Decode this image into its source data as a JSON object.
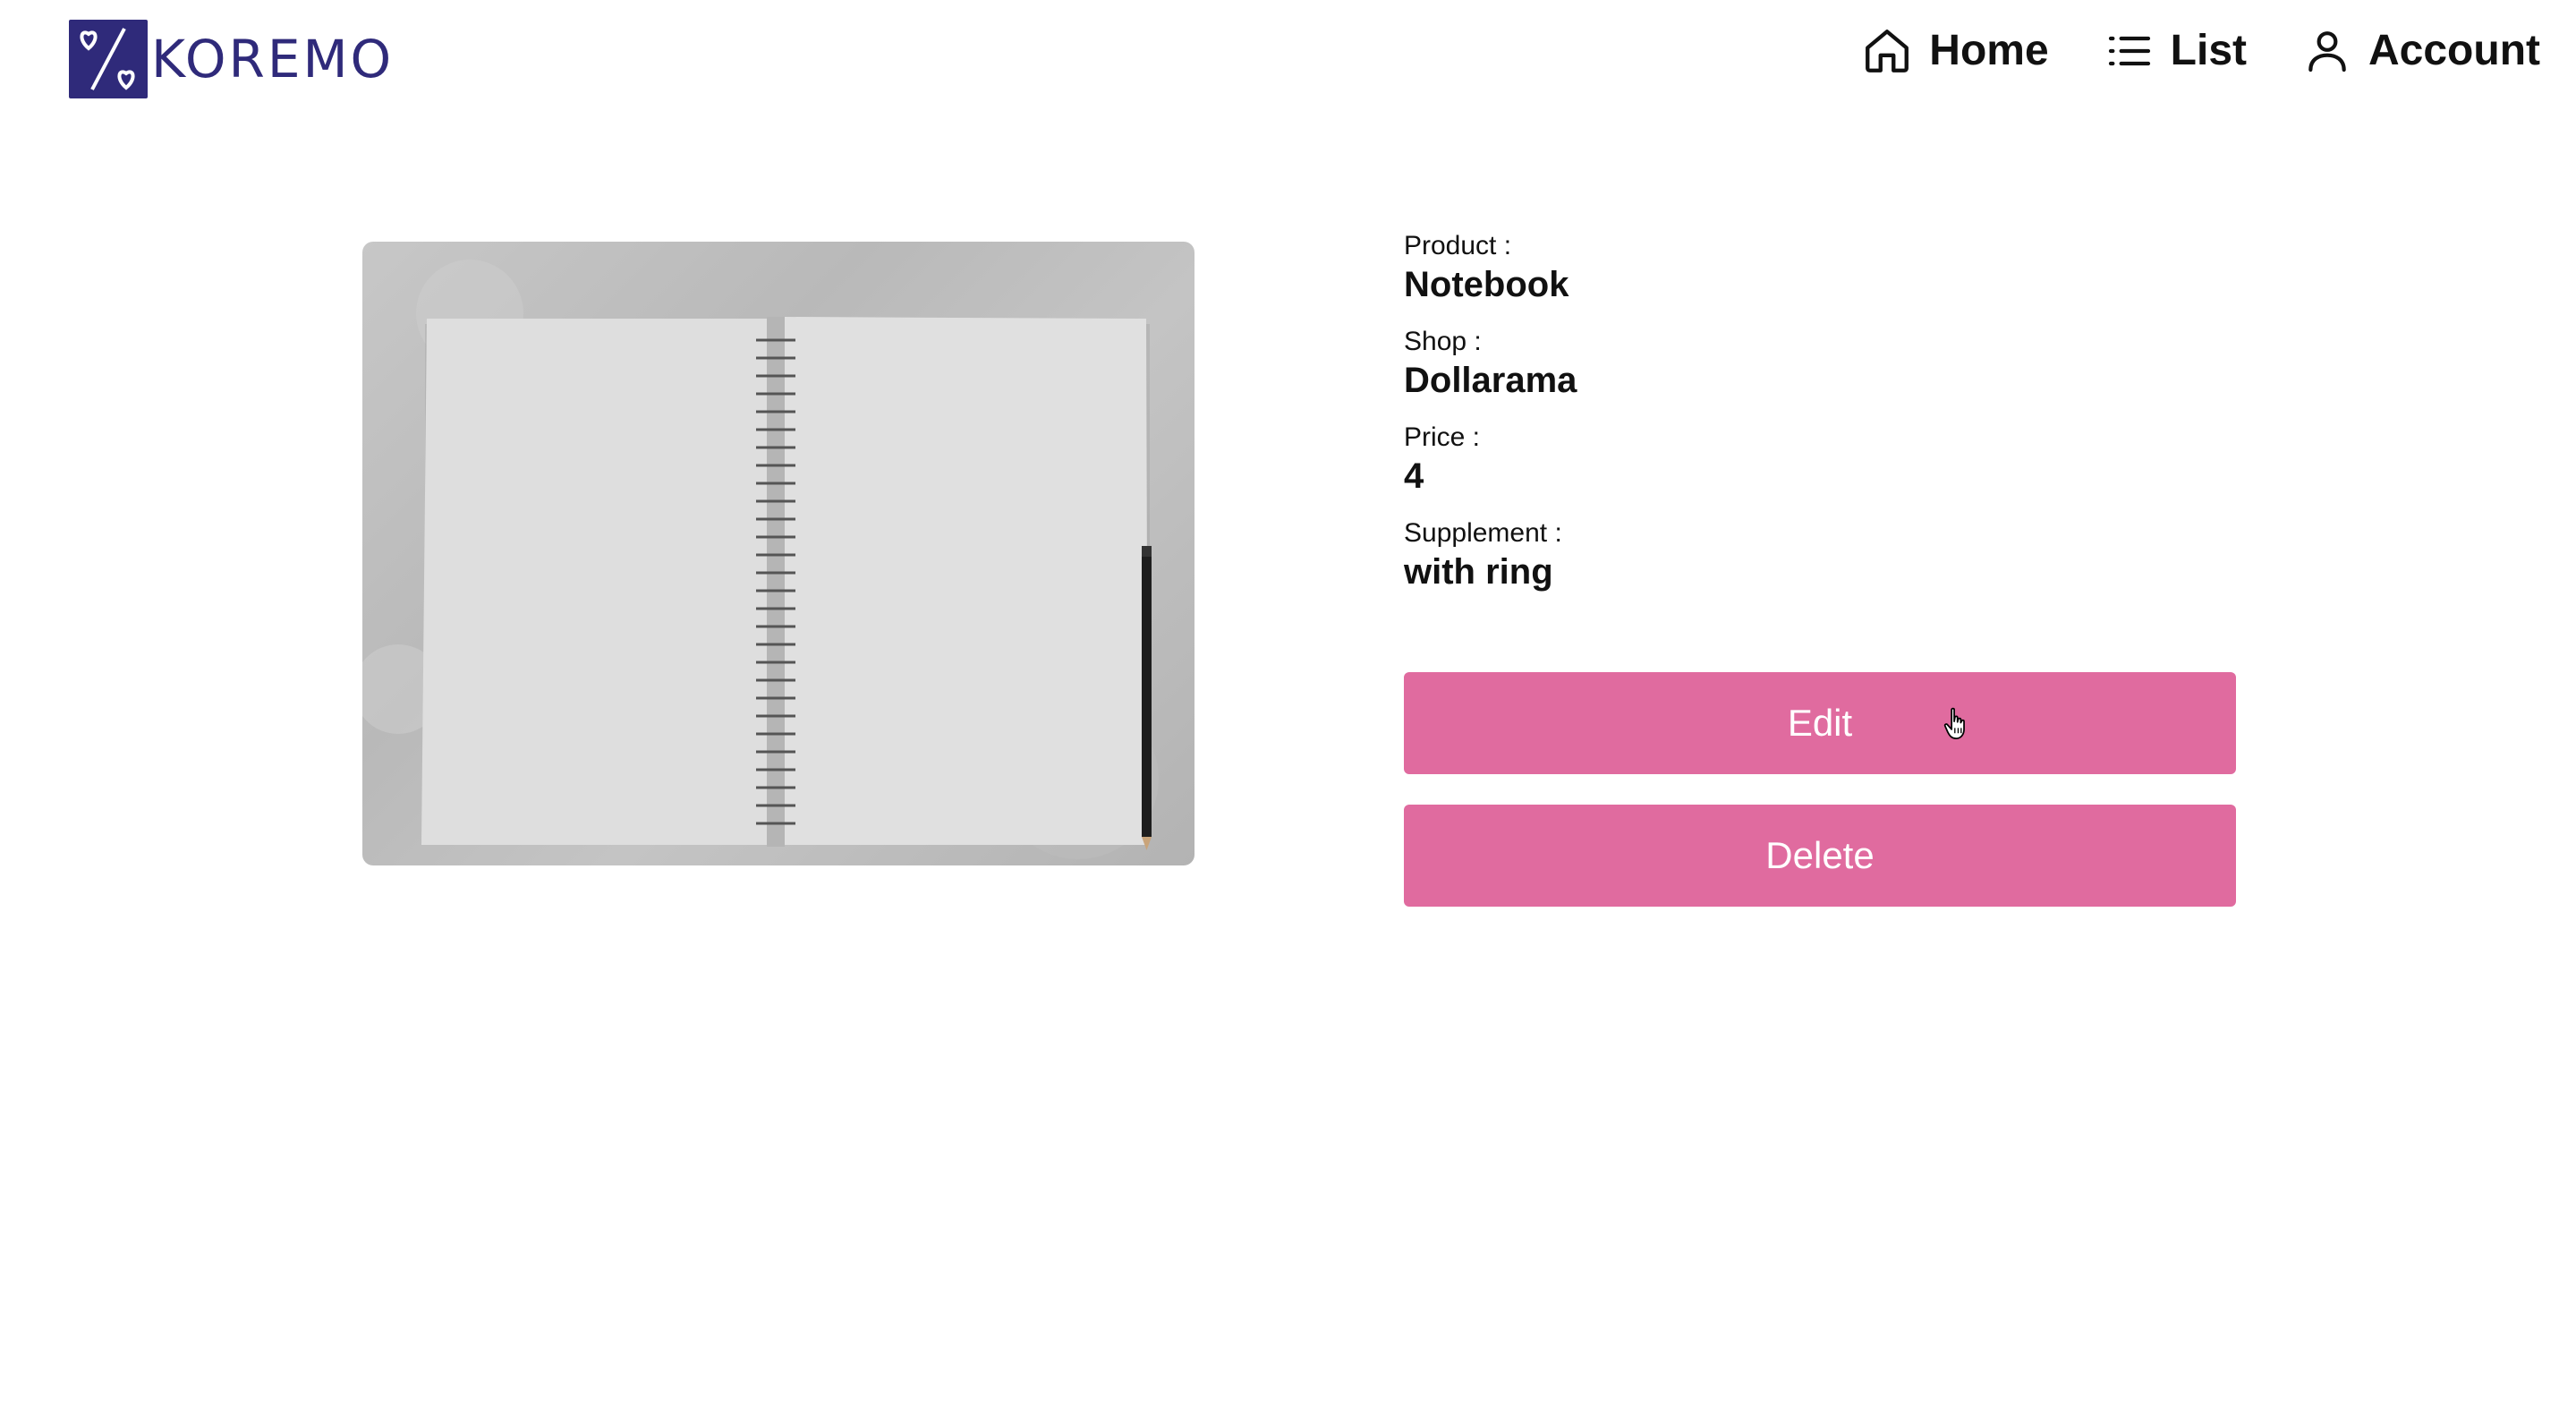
{
  "header": {
    "logo_text": "KOREMO",
    "nav": [
      {
        "label": "Home",
        "icon": "home-icon"
      },
      {
        "label": "List",
        "icon": "list-icon"
      },
      {
        "label": "Account",
        "icon": "user-icon"
      }
    ]
  },
  "product": {
    "image_alt": "Open spiral notebook with pencil",
    "fields": [
      {
        "label": "Product :",
        "value": "Notebook"
      },
      {
        "label": "Shop :",
        "value": "Dollarama"
      },
      {
        "label": "Price :",
        "value": "4"
      },
      {
        "label": "Supplement :",
        "value": "with ring"
      }
    ]
  },
  "actions": {
    "edit_label": "Edit",
    "delete_label": "Delete"
  },
  "colors": {
    "brand": "#2f2a7a",
    "button": "#e06b9f"
  }
}
